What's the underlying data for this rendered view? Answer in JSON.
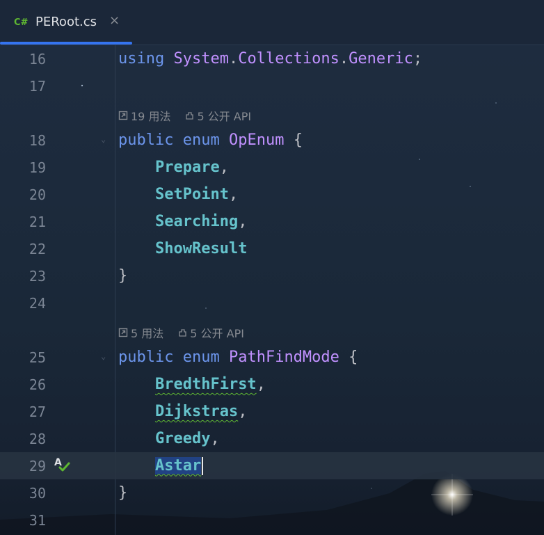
{
  "tab": {
    "lang": "C#",
    "title": "PERoot.cs",
    "close": "×"
  },
  "hints": [
    {
      "usages": "19 用法",
      "api": "5 公开 API"
    },
    {
      "usages": "5 用法",
      "api": "5 公开 API"
    }
  ],
  "lines": {
    "n16": "16",
    "n17": "17",
    "n18": "18",
    "n19": "19",
    "n20": "20",
    "n21": "21",
    "n22": "22",
    "n23": "23",
    "n24": "24",
    "n25": "25",
    "n26": "26",
    "n27": "27",
    "n28": "28",
    "n29": "29",
    "n30": "30",
    "n31": "31"
  },
  "code": {
    "using_kw": "using",
    "using_ns1": "System",
    "using_ns2": "Collections",
    "using_ns3": "Generic",
    "public": "public",
    "enum": "enum",
    "enum1_name": "OpEnum",
    "enum1_members": [
      "Prepare",
      "SetPoint",
      "Searching",
      "ShowResult"
    ],
    "enum2_name": "PathFindMode",
    "enum2_members": [
      "BredthFirst",
      "Dijkstras",
      "Greedy",
      "Astar"
    ],
    "open_brace": "{",
    "close_brace": "}",
    "comma": ",",
    "semicolon": ";",
    "dot": "."
  },
  "gutter": {
    "spellcheck_icon": "A"
  },
  "colors": {
    "keyword": "#6c95eb",
    "type": "#c191ff",
    "member": "#66c3cc",
    "tab_accent": "#3574f0",
    "csharp_badge": "#5fb832"
  }
}
